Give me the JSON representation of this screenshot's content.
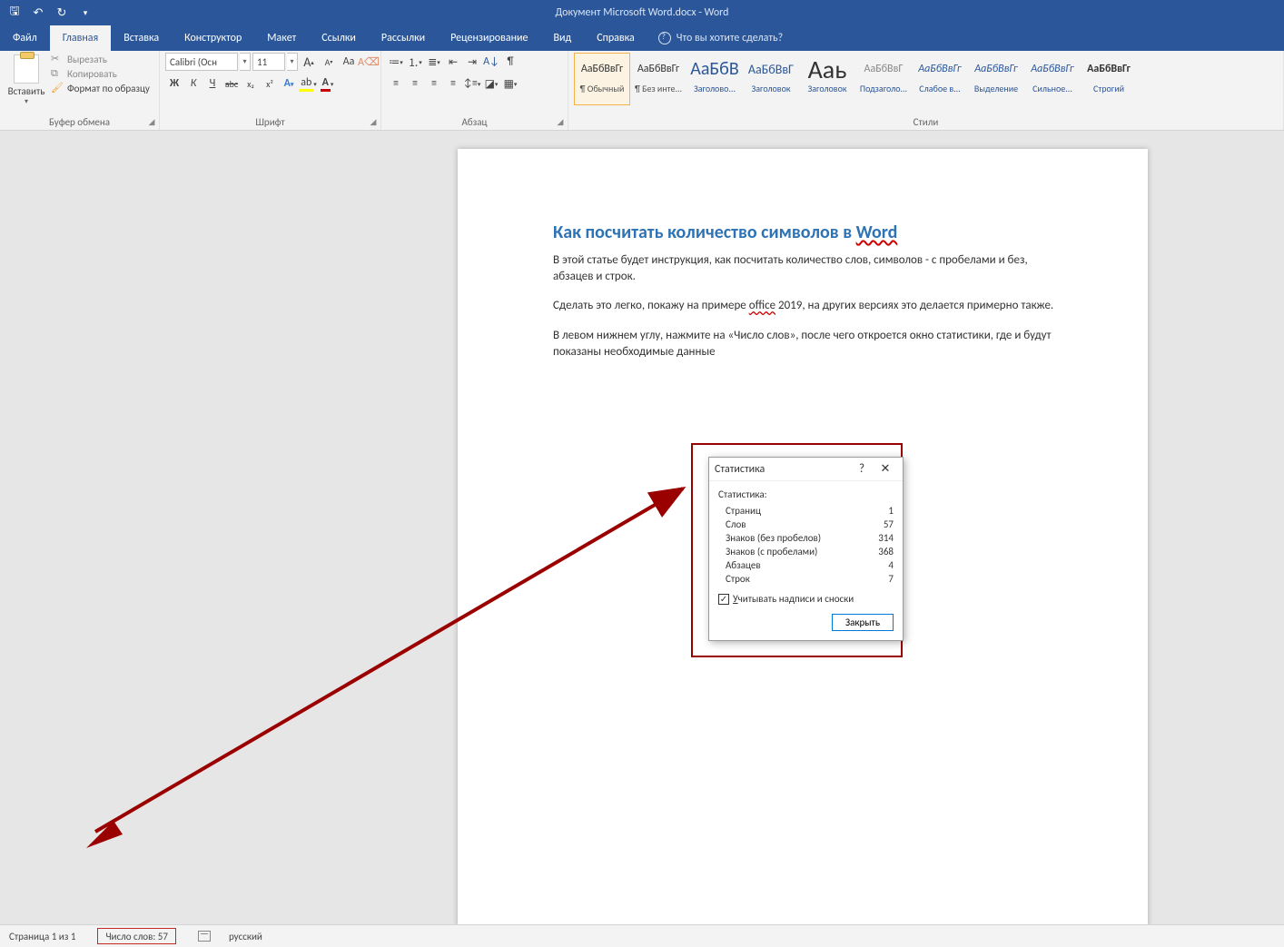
{
  "titlebar": {
    "doc_title": "Документ Microsoft Word.docx  -  Word"
  },
  "tabs": {
    "file": "Файл",
    "list": [
      "Главная",
      "Вставка",
      "Конструктор",
      "Макет",
      "Ссылки",
      "Рассылки",
      "Рецензирование",
      "Вид",
      "Справка"
    ],
    "active_index": 0,
    "tellme": "Что вы хотите сделать?"
  },
  "ribbon": {
    "clipboard": {
      "label": "Буфер обмена",
      "paste": "Вставить",
      "cut": "Вырезать",
      "copy": "Копировать",
      "format_painter": "Формат по образцу"
    },
    "font": {
      "label": "Шрифт",
      "name": "Calibri (Осн",
      "size": "11",
      "grow": "A",
      "shrink": "A",
      "case": "Aa",
      "clear": "⌫",
      "b": "Ж",
      "i": "К",
      "u": "Ч",
      "strike": "abc",
      "sub": "x₂",
      "sup": "x²",
      "effects": "A",
      "highlight": "✎",
      "color": "A"
    },
    "para": {
      "label": "Абзац",
      "bullets": "•",
      "numbers": "1",
      "multilevel": "≣",
      "outdent": "⇤",
      "indent": "⇥",
      "sort": "A↓",
      "marks": "¶",
      "al": "≡",
      "ac": "≡",
      "ar": "≡",
      "aj": "≡",
      "linespace": "↕",
      "shading": "▢",
      "borders": "▦"
    },
    "styles": {
      "label": "Стили",
      "items": [
        {
          "prev": "АаБбВвГг",
          "name": "¶ Обычный",
          "cls": "",
          "sel": true
        },
        {
          "prev": "АаБбВвГг",
          "name": "¶ Без инте...",
          "cls": ""
        },
        {
          "prev": "АаБбВ",
          "name": "Заголово...",
          "cls": "sp-h1"
        },
        {
          "prev": "АаБбВвГ",
          "name": "Заголовок",
          "cls": "sp-h2"
        },
        {
          "prev": "Aаь",
          "name": "Заголовок",
          "cls": "sp-title"
        },
        {
          "prev": "АаБбВвГ",
          "name": "Подзаголо...",
          "cls": "sp-sub"
        },
        {
          "prev": "АаБбВвГг",
          "name": "Слабое в...",
          "cls": "sp-blue"
        },
        {
          "prev": "АаБбВвГг",
          "name": "Выделение",
          "cls": "sp-blue"
        },
        {
          "prev": "АаБбВвГг",
          "name": "Сильное...",
          "cls": "sp-blue"
        },
        {
          "prev": "АаБбВвГг",
          "name": "Строгий",
          "cls": "sp-bold"
        }
      ]
    }
  },
  "document": {
    "heading_a": "Как посчитать количество символов в ",
    "heading_b": "Word",
    "p1": "В этой статье будет инструкция, как посчитать количество слов, символов - с пробелами и без, абзацев и строк.",
    "p2a": "Сделать это легко, покажу на примере ",
    "p2b": "office",
    "p2c": " 2019, на других версиях это делается примерно также.",
    "p3": "В левом нижнем углу, нажмите на «Число слов», после чего откроется окно статистики, где и будут показаны необходимые данные"
  },
  "dialog": {
    "title": "Статистика",
    "section": "Статистика:",
    "rows": [
      {
        "k": "Страниц",
        "v": "1"
      },
      {
        "k": "Слов",
        "v": "57"
      },
      {
        "k": "Знаков (без пробелов)",
        "v": "314"
      },
      {
        "k": "Знаков (с пробелами)",
        "v": "368"
      },
      {
        "k": "Абзацев",
        "v": "4"
      },
      {
        "k": "Строк",
        "v": "7"
      }
    ],
    "checkbox": "Учитывать надписи и сноски",
    "close": "Закрыть"
  },
  "statusbar": {
    "page": "Страница 1 из 1",
    "words": "Число слов: 57",
    "lang": "русский"
  }
}
